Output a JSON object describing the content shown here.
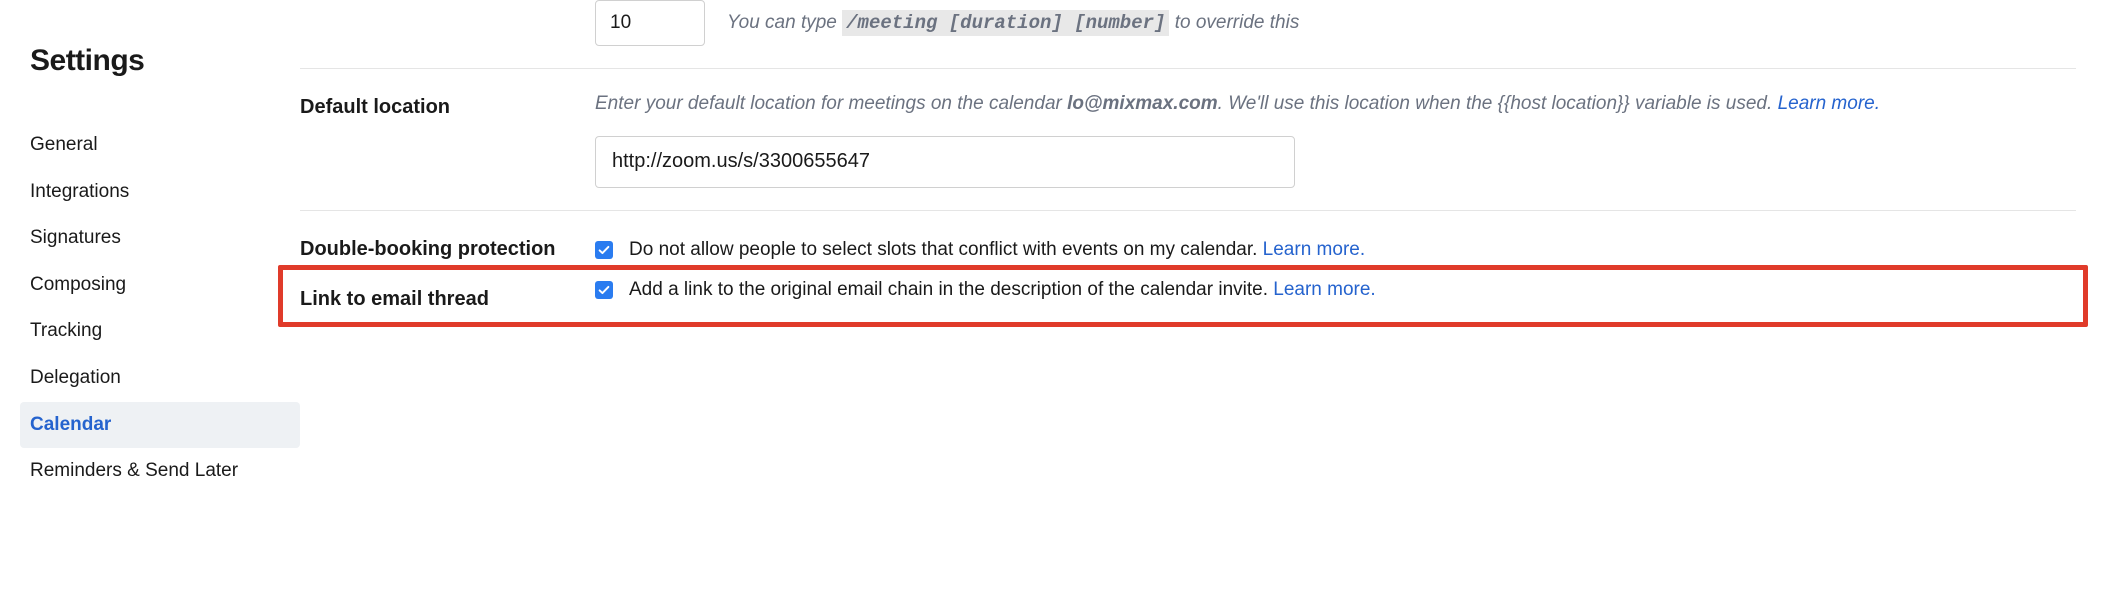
{
  "sidebar": {
    "title": "Settings",
    "items": [
      {
        "label": "General"
      },
      {
        "label": "Integrations"
      },
      {
        "label": "Signatures"
      },
      {
        "label": "Composing"
      },
      {
        "label": "Tracking"
      },
      {
        "label": "Delegation"
      },
      {
        "label": "Calendar",
        "active": true
      },
      {
        "label": "Reminders & Send Later"
      }
    ]
  },
  "meeting_num": {
    "value": "10",
    "hint_prefix": "You can type ",
    "hint_code": "/meeting [duration] [number]",
    "hint_suffix": " to override this"
  },
  "default_location": {
    "label": "Default location",
    "hint_part1": "Enter your default location for meetings on the calendar ",
    "hint_email": "lo@mixmax.com",
    "hint_part2": ". We'll use this location when the {{host location}} variable is used. ",
    "learn": "Learn more.",
    "value": "http://zoom.us/s/3300655647"
  },
  "double_booking": {
    "label": "Double-booking protection",
    "text": "Do not allow people to select slots that conflict with events on my calendar. ",
    "learn": "Learn more."
  },
  "link_email": {
    "label": "Link to email thread",
    "text": "Add a link to the original email chain in the description of the calendar invite. ",
    "learn": "Learn more."
  }
}
